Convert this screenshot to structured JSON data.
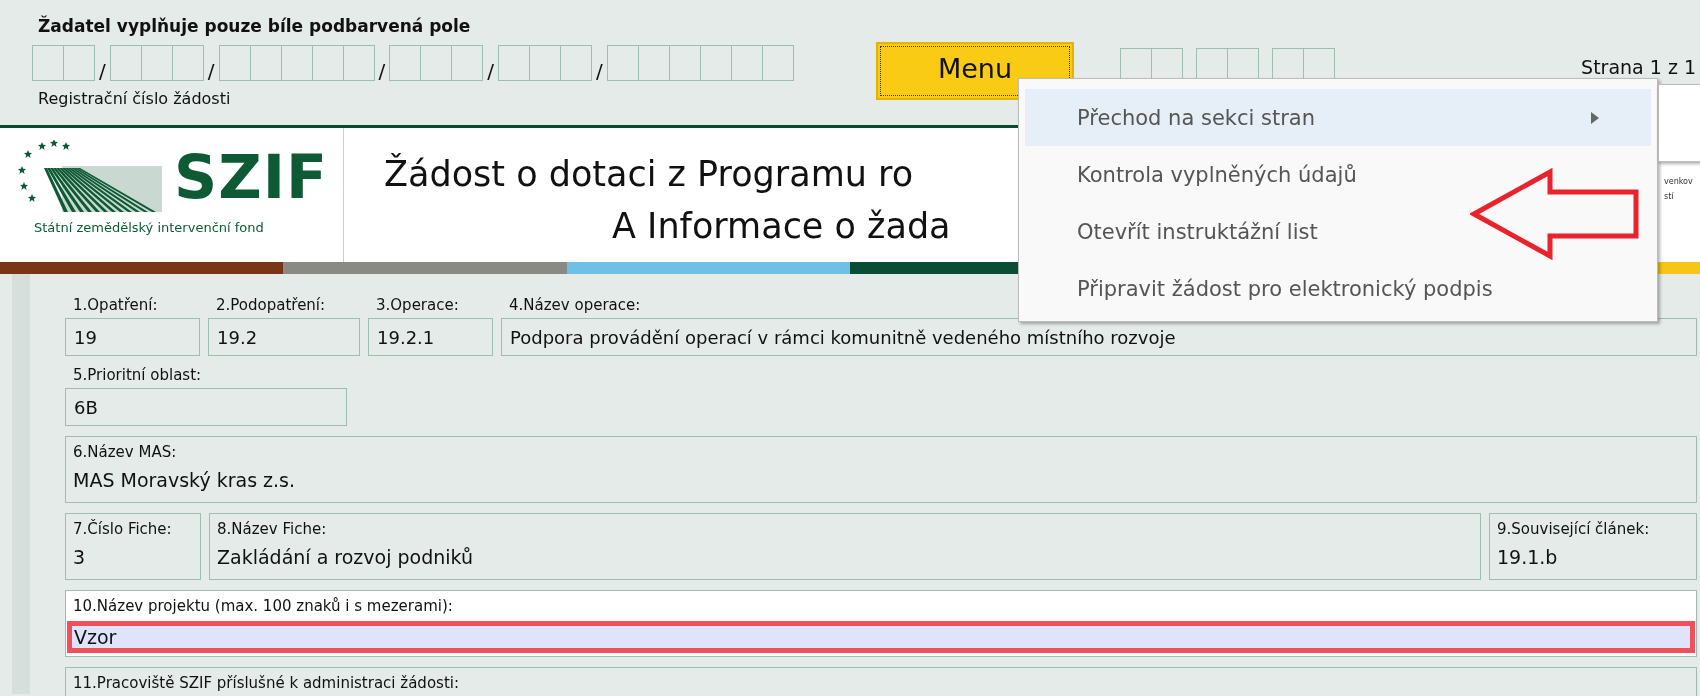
{
  "form_note": "Žadatel vyplňuje pouze bíle podbarvená pole",
  "registration": {
    "separators": [
      "/",
      "/",
      "/",
      "/",
      "/"
    ],
    "label": "Registrační číslo žádosti"
  },
  "menu_button": "Menu",
  "page_indicator": "Strana 1 z 1",
  "logo": {
    "name": "SZIF",
    "subtitle": "Státní zemědělský intervenční fond"
  },
  "header": {
    "title_lines": [
      "Žádost o dotaci z Programu ro",
      "A Informace o žada"
    ],
    "side_text": [
      "venkov",
      "stí"
    ]
  },
  "rows": [
    [
      {
        "label": "1.Opatření:",
        "value": "19",
        "kind": "plain"
      },
      {
        "label": "2.Podopatření:",
        "value": "19.2",
        "kind": "plain"
      },
      {
        "label": "3.Operace:",
        "value": "19.2.1",
        "kind": "plain"
      },
      {
        "label": "4.Název operace:",
        "value": "Podpora provádění operací v rámci komunitně vedeného místního rozvoje",
        "kind": "plain"
      }
    ],
    [
      {
        "label": "5.Prioritní oblast:",
        "value": "6B",
        "kind": "plain"
      }
    ],
    [
      {
        "label": "6.Název MAS:",
        "value": "MAS Moravský kras z.s.",
        "kind": "group"
      }
    ],
    [
      {
        "label": "7.Číslo Fiche:",
        "value": "3",
        "kind": "group"
      },
      {
        "label": "8.Název Fiche:",
        "value": "Zakládání a rozvoj podniků",
        "kind": "group"
      },
      {
        "label": "9.Související článek:",
        "value": "19.1.b",
        "kind": "group"
      }
    ],
    [
      {
        "label": "10.Název projektu (max. 100 znaků i s mezerami):",
        "value": "Vzor",
        "kind": "input",
        "highlighted": true
      }
    ],
    [
      {
        "label": "11.Pracoviště SZIF příslušné k administraci žádosti:",
        "kind": "group"
      }
    ]
  ],
  "menu": {
    "items": [
      {
        "label": "Přechod na sekci stran",
        "selected": true,
        "submenu": true
      },
      {
        "label": "Kontrola vyplněných údajů",
        "selected": false,
        "submenu": false
      },
      {
        "label": "Otevřít instruktážní list",
        "selected": false,
        "submenu": false
      },
      {
        "label": "Připravit žádost pro elektronický podpis",
        "selected": false,
        "submenu": false
      }
    ]
  }
}
